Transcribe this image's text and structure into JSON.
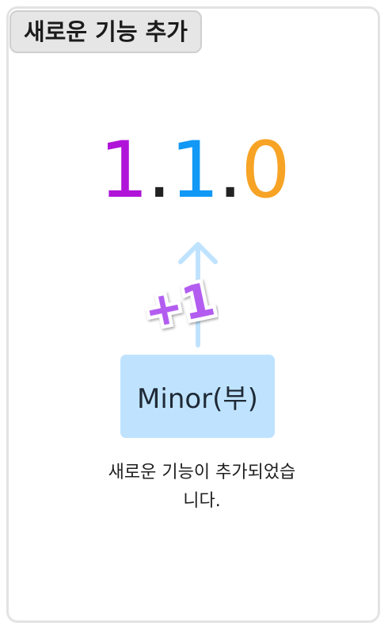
{
  "header": {
    "title": "새로운 기능 추가"
  },
  "version": {
    "major": "1",
    "sep1": ".",
    "minor": "1",
    "sep2": ".",
    "patch": "0",
    "colors": {
      "major": "#b014d8",
      "separator": "#222222",
      "minor": "#1298f5",
      "patch": "#f7a325"
    }
  },
  "bump": {
    "label": "+1",
    "arrow_color": "#bfe3ff",
    "badge_color": "#b25cf0"
  },
  "minor_button": {
    "label": "Minor(부)",
    "color": "#bfe3ff"
  },
  "description": {
    "line1": "새로운 기능이 추가되었습",
    "line2": "니다."
  }
}
